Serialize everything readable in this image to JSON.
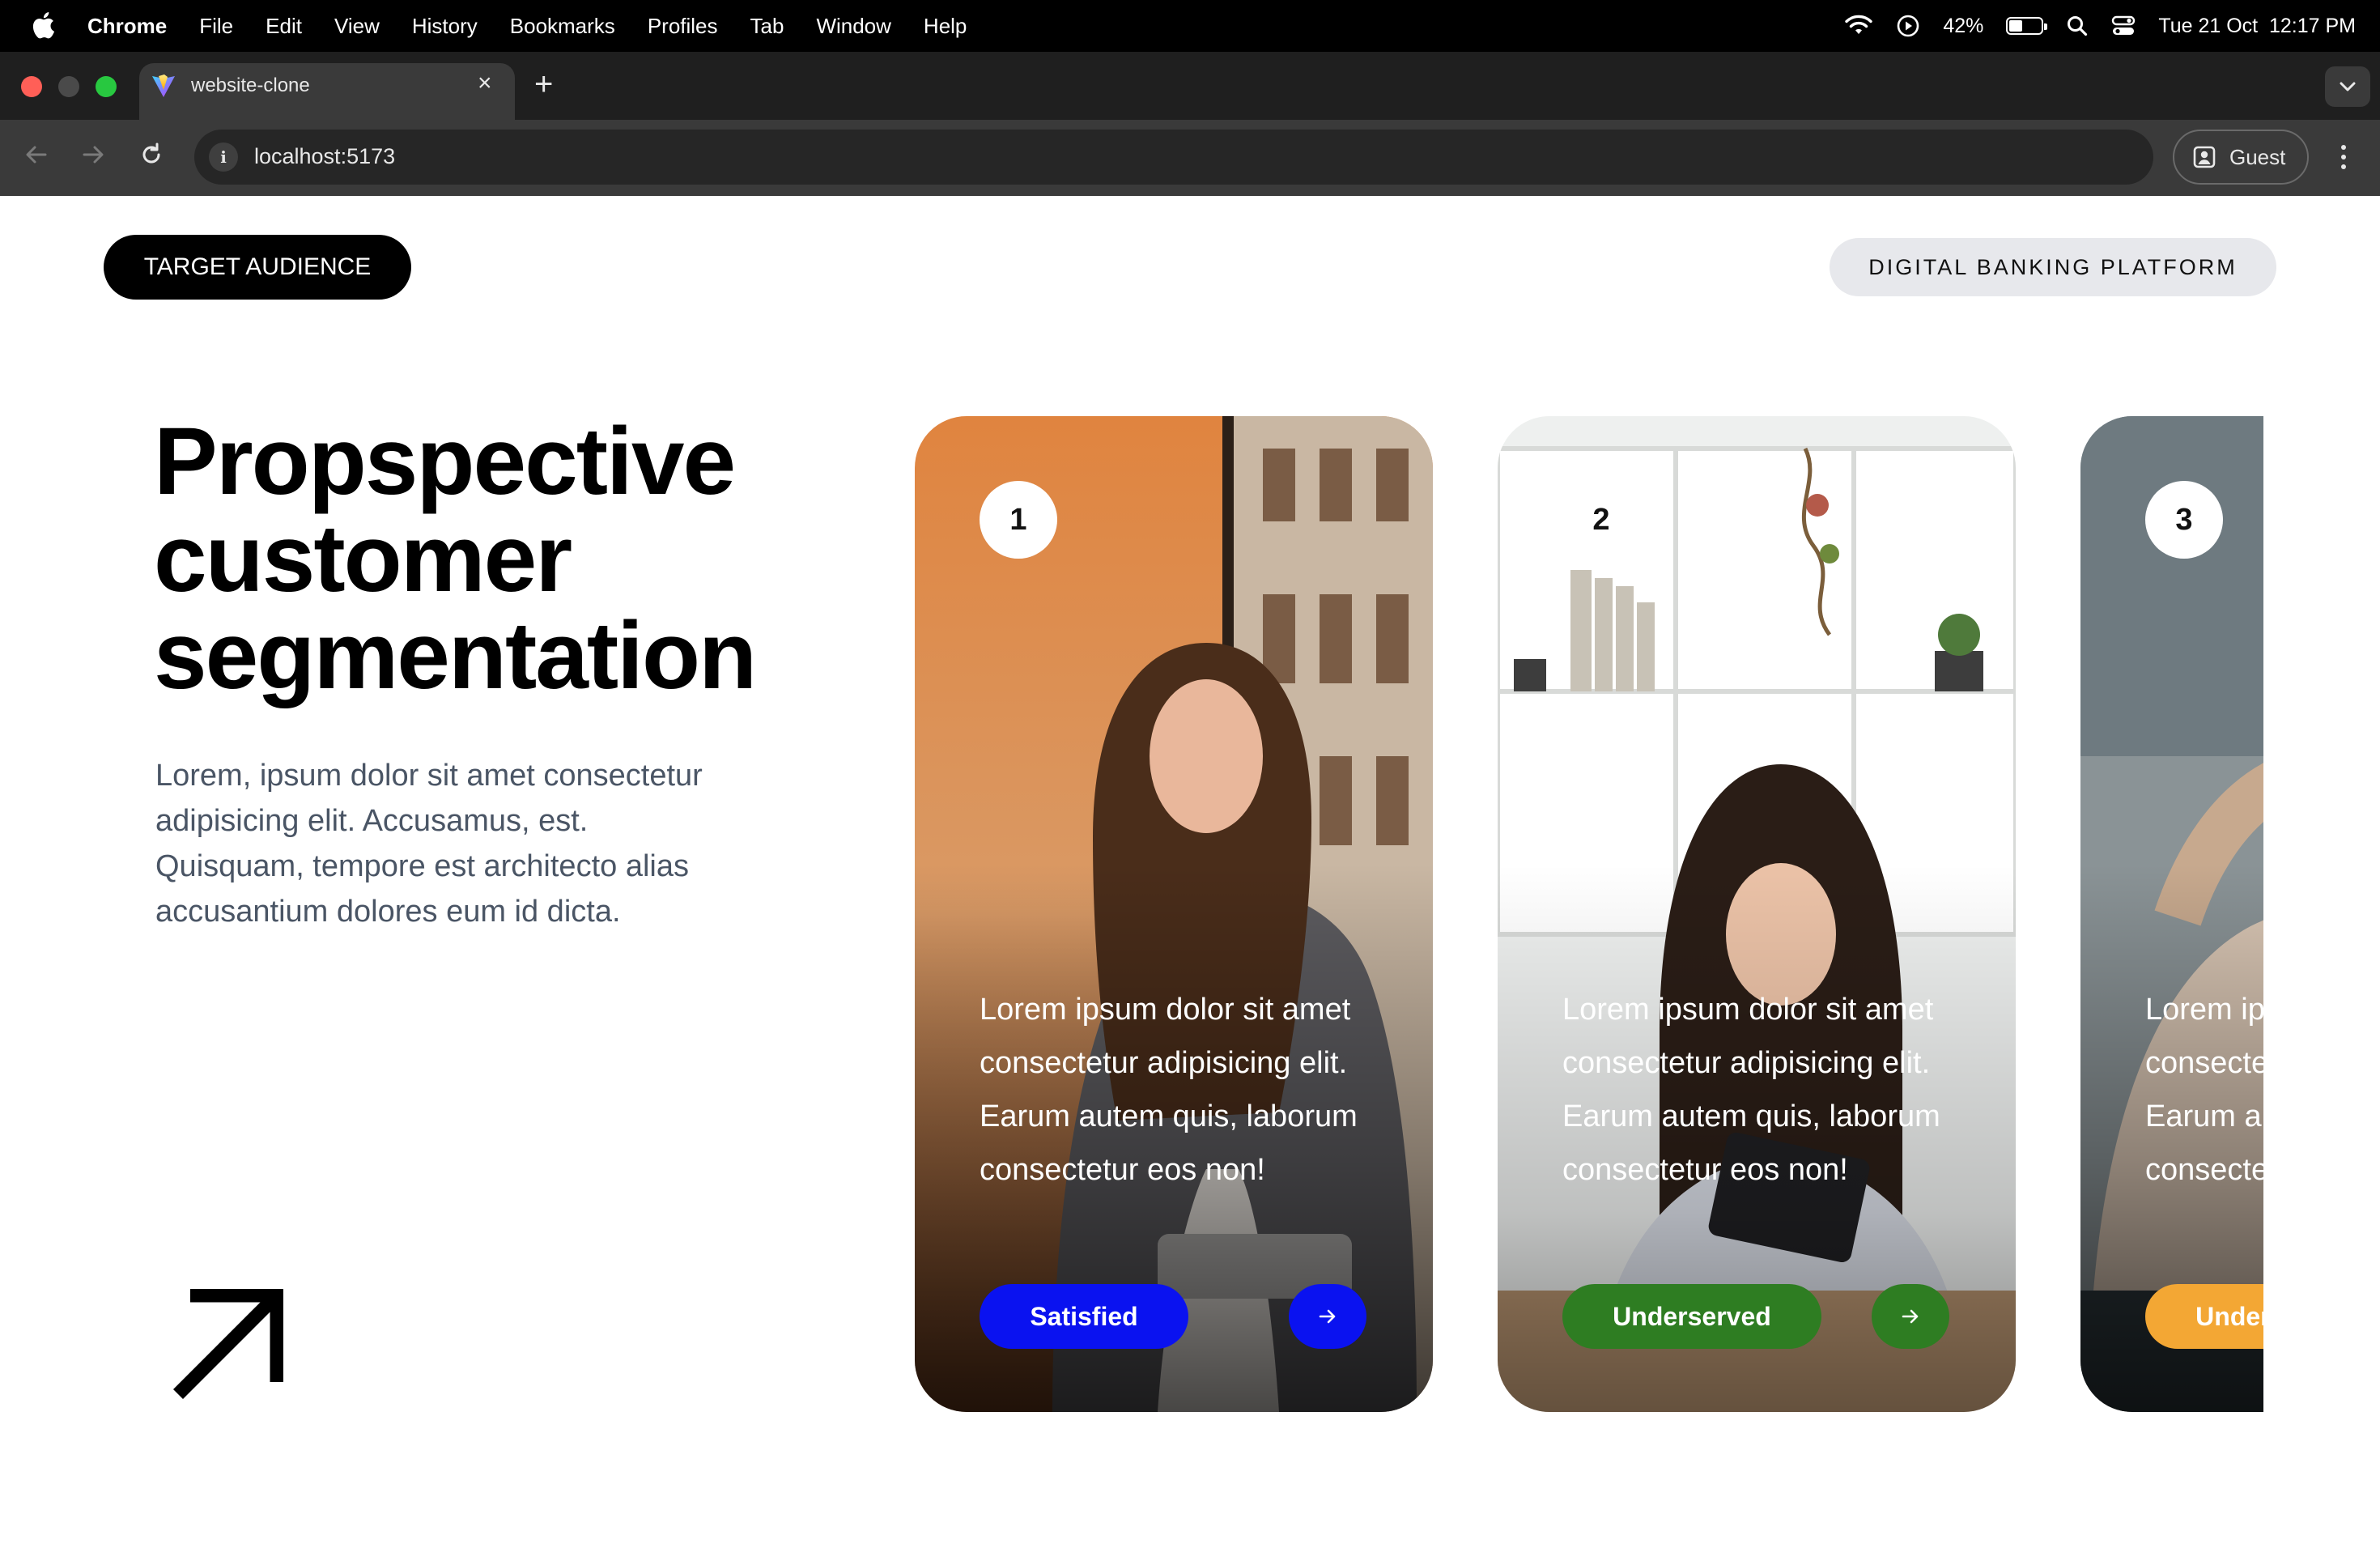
{
  "menubar": {
    "app_name": "Chrome",
    "items": [
      "File",
      "Edit",
      "View",
      "History",
      "Bookmarks",
      "Profiles",
      "Tab",
      "Window",
      "Help"
    ],
    "battery_percent": "42%",
    "battery_level": 0.42,
    "datetime": "Tue 21 Oct  12:17 PM"
  },
  "browser": {
    "tab_title": "website-clone",
    "url": "localhost:5173",
    "profile_label": "Guest"
  },
  "page": {
    "tag_left": "TARGET AUDIENCE",
    "tag_right": "DIGITAL BANKING PLATFORM",
    "headline_lines": [
      "Propspective",
      "customer",
      "segmentation"
    ],
    "lede": "Lorem, ipsum dolor sit amet consectetur adipisicing elit. Accusamus, est. Quisquam, tempore est architecto alias accusantium dolores eum id dicta.",
    "cards": [
      {
        "number": "1",
        "text": "Lorem ipsum dolor sit amet consectetur adipisicing elit. Earum autem quis, laborum consectetur eos non!",
        "segment": "Satisfied",
        "color": "#0a12f0"
      },
      {
        "number": "2",
        "text": "Lorem ipsum dolor sit amet consectetur adipisicing elit. Earum autem quis, laborum consectetur eos non!",
        "segment": "Underserved",
        "color": "#2e7d22"
      },
      {
        "number": "3",
        "text": "Lorem ipsum dolor sit amet consectetur adipisicing elit. Earum autem quis, laborum consectetur eos non!",
        "segment": "Underserved",
        "color": "#f3a734"
      }
    ]
  },
  "colors": {
    "menubar_bg": "#000000",
    "tabstrip_bg": "#1f1f1f",
    "toolbar_bg": "#3a3a3a",
    "lede_text": "#4a5565",
    "pill_light_bg": "#e7e8ec"
  },
  "icons": {
    "menubar": [
      "apple-icon",
      "wifi-icon",
      "play-icon",
      "battery-icon",
      "search-icon",
      "control-center-icon"
    ],
    "browser": [
      "close-icon",
      "plus-icon",
      "chevron-down-icon",
      "back-icon",
      "forward-icon",
      "reload-icon",
      "info-icon",
      "profile-icon",
      "more-icon"
    ],
    "page": [
      "arrow-up-right-icon",
      "arrow-right-icon"
    ]
  }
}
